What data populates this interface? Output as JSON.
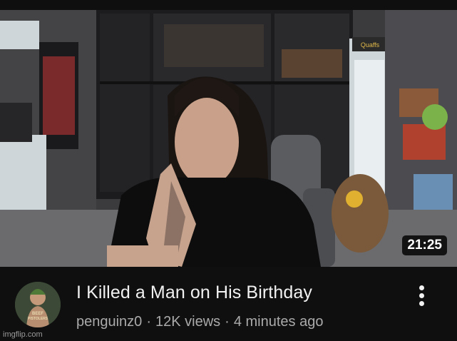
{
  "video": {
    "duration": "21:25",
    "title": "I Killed a Man on His Birthday",
    "channel": "penguinz0",
    "views": "12K views",
    "age": "4 minutes ago",
    "separator": "·"
  },
  "avatar": {
    "text_top": "BEEF",
    "text_bottom": "PISTOLERS"
  },
  "thumbnail": {
    "shop_sign": "Quaffs"
  },
  "watermark": "imgflip.com",
  "icons": {
    "menu": "more-vertical-icon"
  },
  "colors": {
    "background": "#0f0f0f",
    "title": "#f1f1f1",
    "subtext": "#aaaaaa"
  }
}
